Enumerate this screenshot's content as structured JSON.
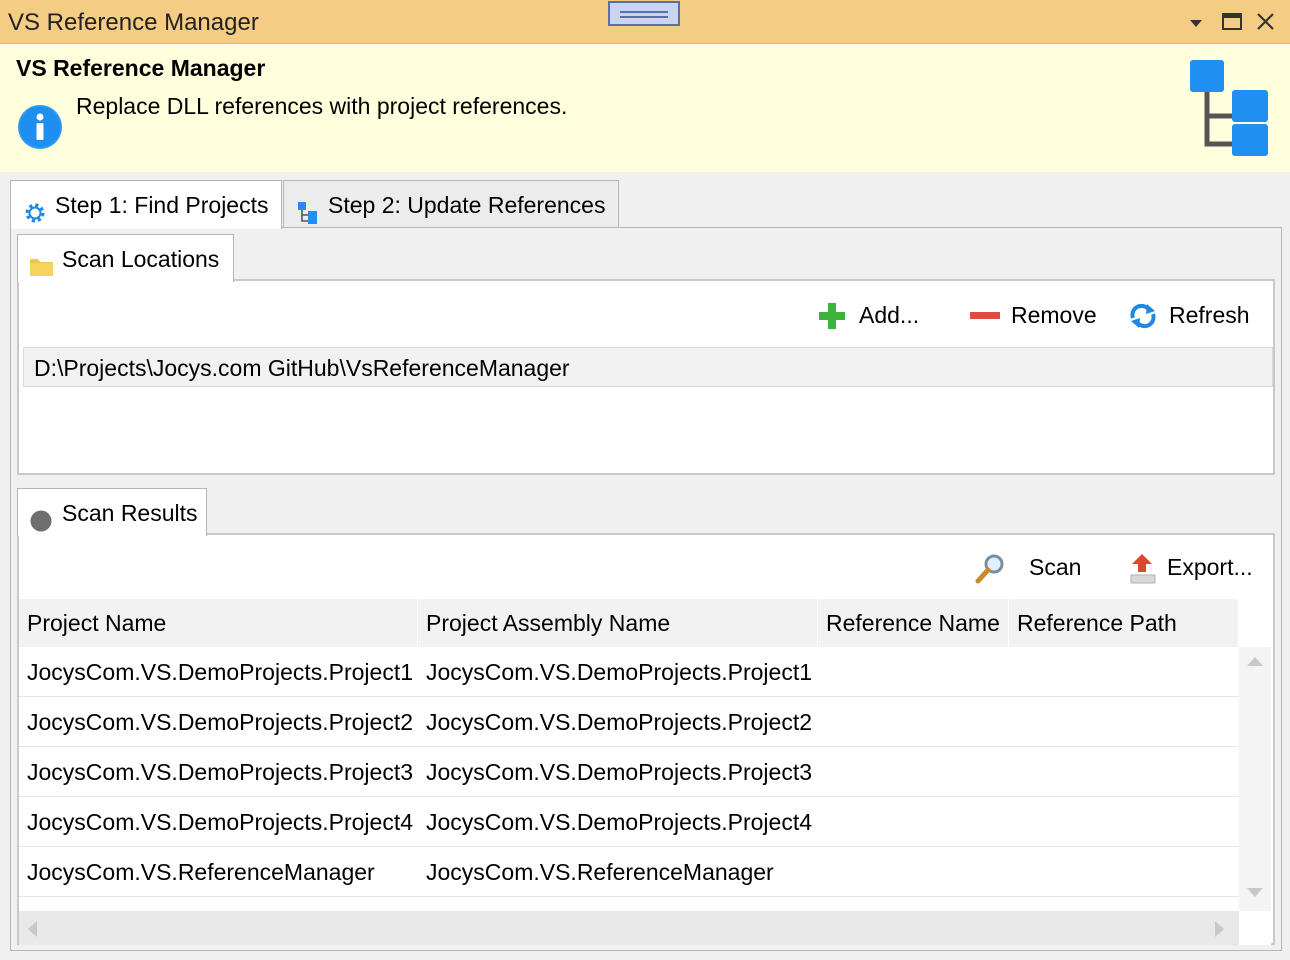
{
  "window": {
    "title": "VS Reference Manager"
  },
  "header": {
    "title": "VS Reference Manager",
    "description": "Replace DLL references with project references."
  },
  "tabs": [
    {
      "label": "Step 1: Find Projects",
      "selected": true
    },
    {
      "label": "Step 2: Update References",
      "selected": false
    }
  ],
  "scan_locations": {
    "label": "Scan Locations",
    "toolbar": {
      "add_label": "Add...",
      "remove_label": "Remove",
      "refresh_label": "Refresh"
    },
    "items": [
      "D:\\Projects\\Jocys.com GitHub\\VsReferenceManager"
    ]
  },
  "scan_results": {
    "label": "Scan Results",
    "toolbar": {
      "scan_label": "Scan",
      "export_label": "Export..."
    },
    "columns": [
      "Project Name",
      "Project Assembly Name",
      "Reference Name",
      "Reference Path"
    ],
    "rows": [
      [
        "JocysCom.VS.DemoProjects.Project1",
        "JocysCom.VS.DemoProjects.Project1",
        "",
        ""
      ],
      [
        "JocysCom.VS.DemoProjects.Project2",
        "JocysCom.VS.DemoProjects.Project2",
        "",
        ""
      ],
      [
        "JocysCom.VS.DemoProjects.Project3",
        "JocysCom.VS.DemoProjects.Project3",
        "",
        ""
      ],
      [
        "JocysCom.VS.DemoProjects.Project4",
        "JocysCom.VS.DemoProjects.Project4",
        "",
        ""
      ],
      [
        "JocysCom.VS.ReferenceManager",
        "JocysCom.VS.ReferenceManager",
        "",
        ""
      ]
    ]
  },
  "colors": {
    "titlebar": "#f5cc84",
    "header_bg": "#ffffdd",
    "info_blue": "#1e90ff",
    "add_green": "#3cb33c",
    "remove_red": "#e04a3f"
  }
}
